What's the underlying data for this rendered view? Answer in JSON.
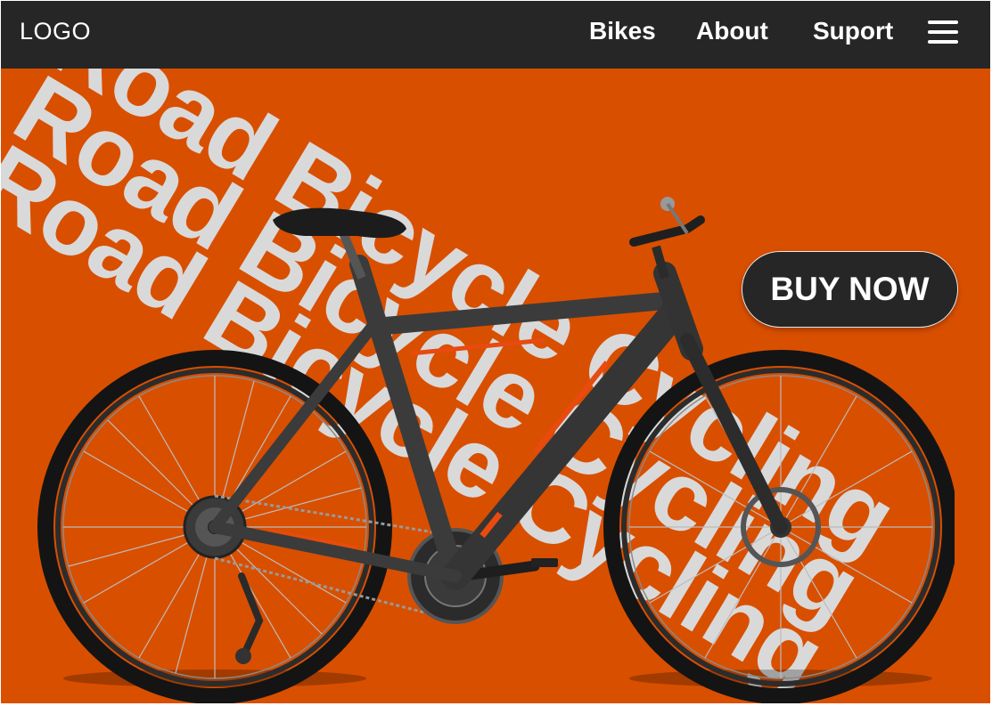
{
  "brand": {
    "logo_text": "LOGO"
  },
  "nav": {
    "items": [
      {
        "label": "Bikes"
      },
      {
        "label": "About"
      },
      {
        "label": "Suport"
      }
    ],
    "menu_icon": "hamburger-menu-icon"
  },
  "hero": {
    "headline_lines": [
      "Road Bicycle Cycling",
      "Road Bicycle Cycling",
      "Road Bicycle Cycling"
    ],
    "cta_label": "BUY NOW",
    "product_image": "road-bicycle"
  },
  "colors": {
    "header_background": "#262626",
    "hero_background": "#d94f00",
    "headline_text": "#d9d9d9",
    "button_background": "#262626",
    "bike_frame": "#3b3b3b",
    "bike_accent": "#e84a10"
  }
}
